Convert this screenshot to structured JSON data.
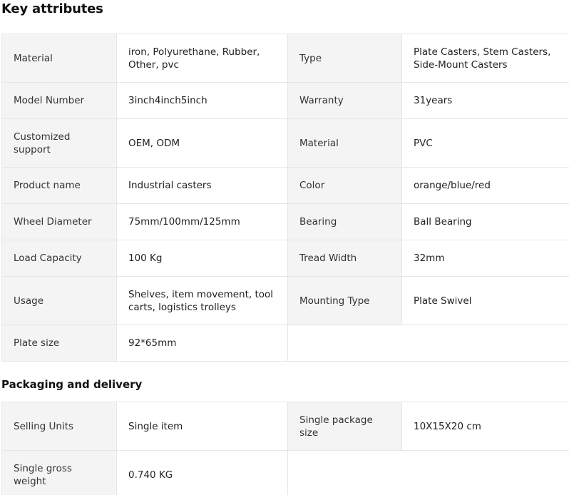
{
  "key_attributes": {
    "title": "Key attributes",
    "rows": [
      [
        {
          "label": "Material",
          "value": "iron, Polyurethane, Rubber, Other, pvc"
        },
        {
          "label": "Type",
          "value": "Plate Casters, Stem Casters, Side-Mount Casters"
        }
      ],
      [
        {
          "label": "Model Number",
          "value": "3inch4inch5inch"
        },
        {
          "label": "Warranty",
          "value": "31years"
        }
      ],
      [
        {
          "label": "Customized support",
          "value": "OEM, ODM"
        },
        {
          "label": "Material",
          "value": "PVC"
        }
      ],
      [
        {
          "label": "Product name",
          "value": "Industrial casters"
        },
        {
          "label": "Color",
          "value": "orange/blue/red"
        }
      ],
      [
        {
          "label": "Wheel Diameter",
          "value": "75mm/100mm/125mm"
        },
        {
          "label": "Bearing",
          "value": "Ball Bearing"
        }
      ],
      [
        {
          "label": "Load Capacity",
          "value": "100 Kg"
        },
        {
          "label": "Tread Width",
          "value": "32mm"
        }
      ],
      [
        {
          "label": "Usage",
          "value": "Shelves, item movement, tool carts, logistics trolleys"
        },
        {
          "label": "Mounting Type",
          "value": "Plate Swivel"
        }
      ],
      [
        {
          "label": "Plate size",
          "value": "92*65mm"
        }
      ]
    ]
  },
  "packaging": {
    "title": "Packaging and delivery",
    "rows": [
      [
        {
          "label": "Selling Units",
          "value": "Single item"
        },
        {
          "label": "Single package size",
          "value": "10X15X20 cm"
        }
      ],
      [
        {
          "label": "Single gross weight",
          "value": "0.740 KG"
        }
      ]
    ]
  }
}
